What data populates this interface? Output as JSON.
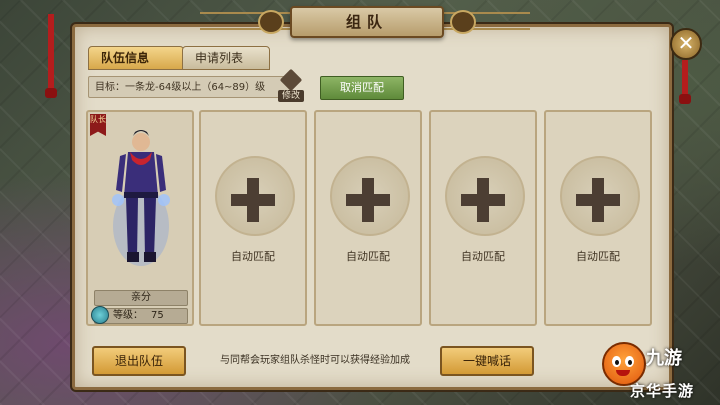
{
  "window": {
    "title": "组队"
  },
  "tabs": [
    {
      "label": "队伍信息",
      "active": true
    },
    {
      "label": "申请列表",
      "active": false
    }
  ],
  "target": {
    "text": "目标：一条龙-64级以上（64~89）级",
    "edit_label": "修改"
  },
  "buttons": {
    "cancel_match": "取消匹配",
    "leave_team": "退出队伍",
    "shout": "一键喊话"
  },
  "leader": {
    "badge": "队长",
    "name": "亲分",
    "level_label": "等级：",
    "level_value": "75"
  },
  "empty_slots": [
    {
      "label": "自动匹配"
    },
    {
      "label": "自动匹配"
    },
    {
      "label": "自动匹配"
    },
    {
      "label": "自动匹配"
    }
  ],
  "tip": "与同帮会玩家组队杀怪时可以获得经验加成",
  "watermark": {
    "brand": "九游",
    "sub": "京华手游"
  },
  "colors": {
    "panel_bg": "#e3dcc9",
    "accent_gold": "#d39a35",
    "accent_green": "#5f8a3a",
    "badge_red": "#8d1a1a"
  }
}
